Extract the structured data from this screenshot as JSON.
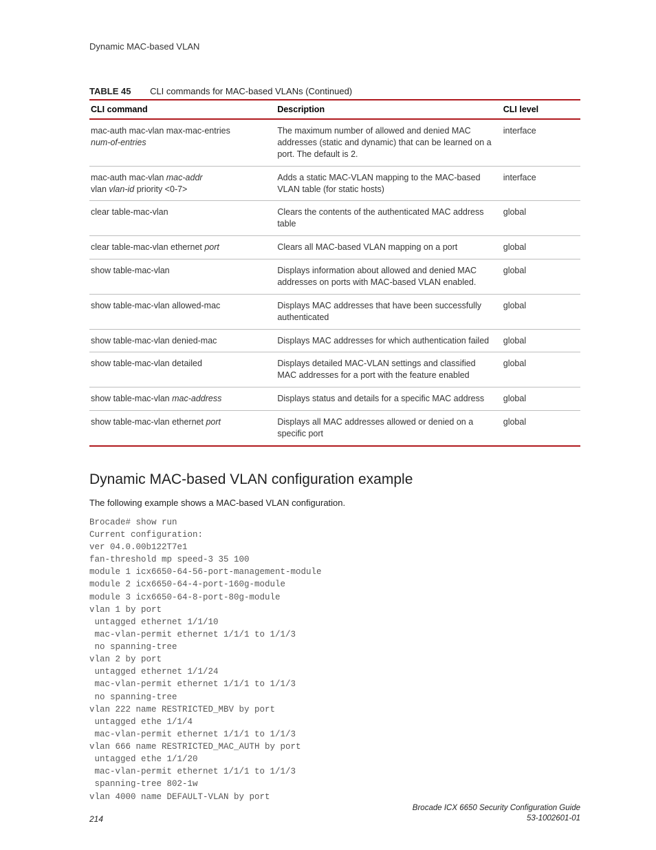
{
  "header": {
    "running": "Dynamic MAC-based VLAN"
  },
  "table": {
    "label": "TABLE 45",
    "caption": "CLI commands for MAC-based VLANs (Continued)",
    "columns": {
      "cmd": "CLI command",
      "desc": "Description",
      "level": "CLI level"
    },
    "rows": [
      {
        "cmd_plain": "mac-auth mac-vlan max-mac-entries",
        "cmd_ital": "num-of-entries",
        "desc": "The maximum number of allowed and denied MAC addresses (static and dynamic) that can be learned on a port. The default is 2.",
        "level": "interface"
      },
      {
        "cmd_plain_a": "mac-auth mac-vlan ",
        "cmd_ital_a": "mac-addr",
        "cmd_plain_b": "vlan ",
        "cmd_ital_b": "vlan-id",
        "cmd_plain_c": " priority <0-7>",
        "desc": "Adds a static MAC-VLAN mapping to the MAC-based VLAN table (for static hosts)",
        "level": "interface"
      },
      {
        "cmd_plain": "clear table-mac-vlan",
        "desc": "Clears the contents of the authenticated MAC address table",
        "level": "global"
      },
      {
        "cmd_plain": "clear table-mac-vlan ethernet ",
        "cmd_ital": "port",
        "desc": "Clears all MAC-based VLAN mapping on a port",
        "level": "global"
      },
      {
        "cmd_plain": "show table-mac-vlan",
        "desc": "Displays information about allowed and denied MAC addresses on ports with MAC-based VLAN enabled.",
        "level": "global"
      },
      {
        "cmd_plain": "show table-mac-vlan allowed-mac",
        "desc": "Displays MAC addresses that have been successfully authenticated",
        "level": "global"
      },
      {
        "cmd_plain": "show table-mac-vlan denied-mac",
        "desc": "Displays MAC addresses for which authentication failed",
        "level": "global"
      },
      {
        "cmd_plain": "show table-mac-vlan detailed",
        "desc": "Displays detailed MAC-VLAN settings and classified MAC addresses for a port with the feature enabled",
        "level": "global"
      },
      {
        "cmd_plain": "show table-mac-vlan ",
        "cmd_ital": "mac-address",
        "desc": "Displays status and details for a specific MAC address",
        "level": "global"
      },
      {
        "cmd_plain": "show table-mac-vlan ethernet ",
        "cmd_ital": "port",
        "desc": "Displays all MAC addresses allowed or denied on a specific port",
        "level": "global"
      }
    ]
  },
  "section": {
    "heading": "Dynamic MAC-based VLAN configuration example",
    "intro": "The following example shows a MAC-based VLAN configuration.",
    "code": "Brocade# show run\nCurrent configuration:\nver 04.0.00b122T7e1\nfan-threshold mp speed-3 35 100\nmodule 1 icx6650-64-56-port-management-module\nmodule 2 icx6650-64-4-port-160g-module\nmodule 3 icx6650-64-8-port-80g-module\nvlan 1 by port\n untagged ethernet 1/1/10\n mac-vlan-permit ethernet 1/1/1 to 1/1/3\n no spanning-tree\nvlan 2 by port\n untagged ethernet 1/1/24\n mac-vlan-permit ethernet 1/1/1 to 1/1/3\n no spanning-tree\nvlan 222 name RESTRICTED_MBV by port\n untagged ethe 1/1/4\n mac-vlan-permit ethernet 1/1/1 to 1/1/3\nvlan 666 name RESTRICTED_MAC_AUTH by port\n untagged ethe 1/1/20\n mac-vlan-permit ethernet 1/1/1 to 1/1/3\n spanning-tree 802-1w\nvlan 4000 name DEFAULT-VLAN by port"
  },
  "footer": {
    "page": "214",
    "doc_title": "Brocade ICX 6650 Security Configuration Guide",
    "doc_num": "53-1002601-01"
  }
}
